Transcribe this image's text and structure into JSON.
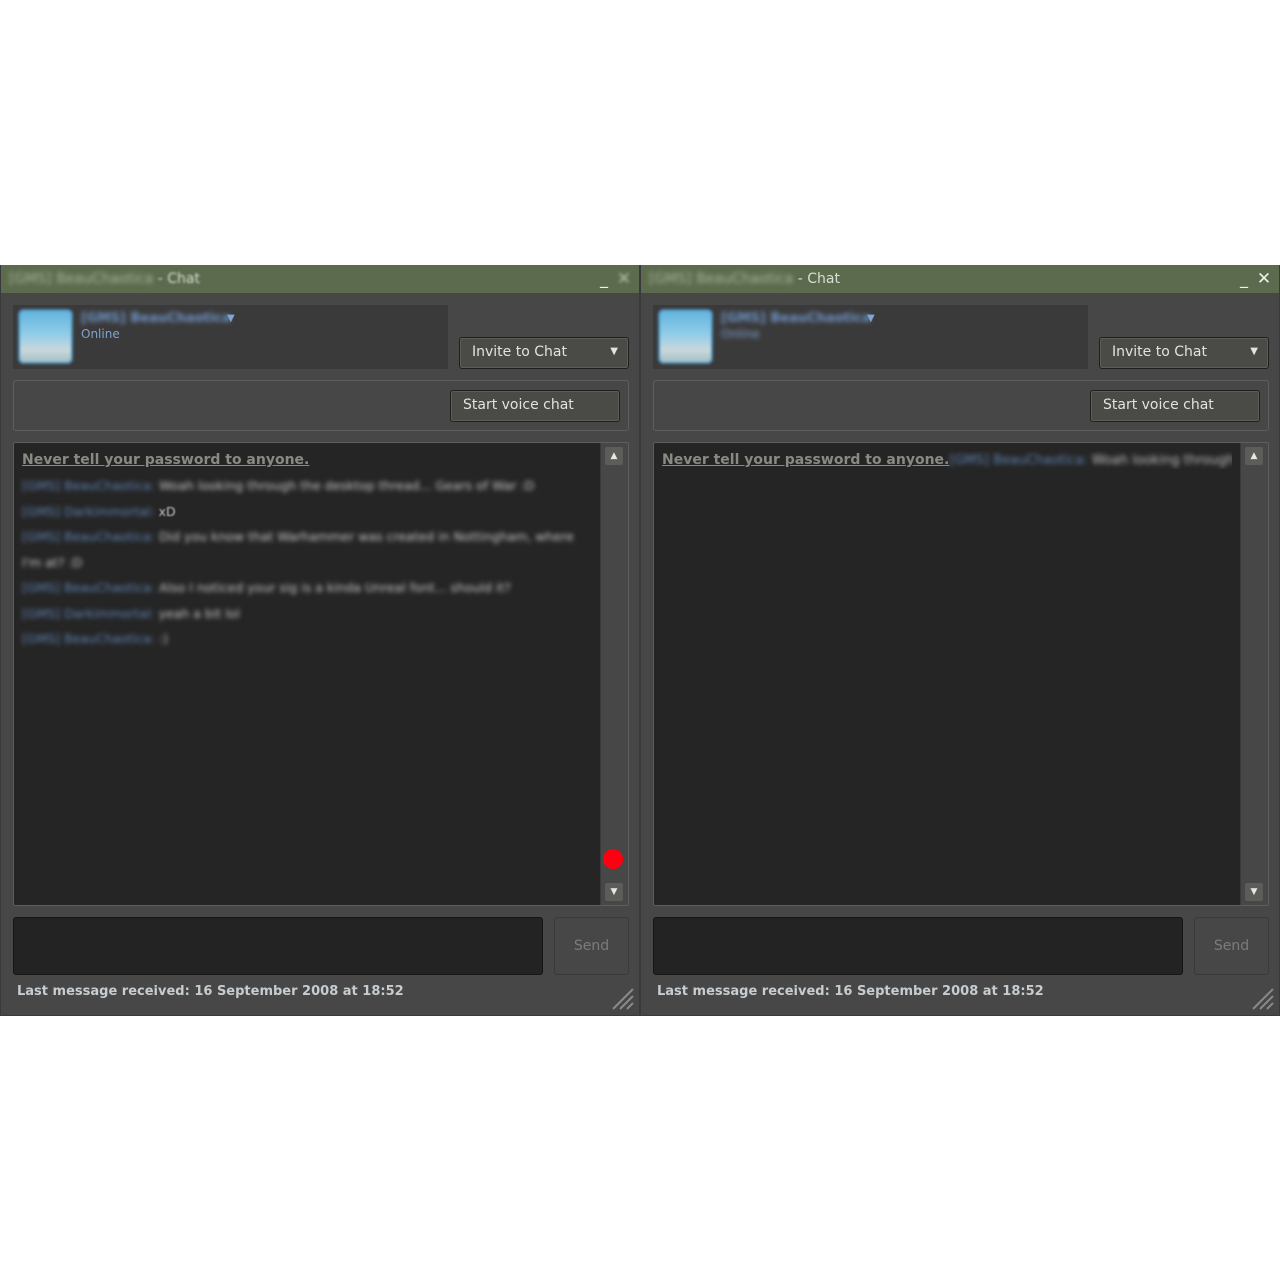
{
  "windows": [
    {
      "id": "left",
      "title_name": "[GMS] BeauChaotica",
      "title_suffix": " - Chat",
      "minimize_glyph": "_",
      "close_glyph": "✕",
      "profile": {
        "name": "[GMS] BeauChaotica",
        "status": "Online",
        "caret": "▼"
      },
      "invite_label": "Invite to Chat",
      "invite_caret": "▼",
      "voice_label": "Start voice chat",
      "warning": "Never tell your password to anyone.",
      "messages": [
        {
          "who": "[GMS] BeauChaotica:",
          "text": "Woah looking through the desktop thread... Gears of War :D"
        },
        {
          "who": "[GMS] Darkimmortal:",
          "text": "xD",
          "clear": true
        },
        {
          "who": "[GMS] BeauChaotica:",
          "text": "Did you know that Warhammer was created in Nottingham, where"
        },
        {
          "who": "",
          "text": "I'm at? :D"
        },
        {
          "who": "[GMS] BeauChaotica:",
          "text": "Also I noticed your sig is a kinda Unreal font... should it?"
        },
        {
          "who": "[GMS] Darkimmortal:",
          "text": "yeah a bit lol"
        },
        {
          "who": "[GMS] BeauChaotica:",
          "text": ":)"
        }
      ],
      "scroll_up": "▲",
      "scroll_down": "▼",
      "input_value": "",
      "send_label": "Send",
      "status": "Last message received: 16 September 2008 at 18:52",
      "show_click_marker": true
    },
    {
      "id": "right",
      "title_name": "[GMS] BeauChaotica",
      "title_suffix": " - Chat",
      "minimize_glyph": "_",
      "close_glyph": "✕",
      "profile": {
        "name": "[GMS] BeauChaotica",
        "status": "Online",
        "caret": "▼"
      },
      "invite_label": "Invite to Chat",
      "invite_caret": "▼",
      "voice_label": "Start voice chat",
      "warning": "Never tell your password to anyone.",
      "inline_message": {
        "who": "[GMS] BeauChaotica:",
        "text": "Woah looking through the"
      },
      "scroll_up": "▲",
      "scroll_down": "▼",
      "input_value": "",
      "send_label": "Send",
      "status": "Last message received: 16 September 2008 at 18:52",
      "show_click_marker": false
    }
  ],
  "colors": {
    "titlebar": "#5c6b4d",
    "window_bg": "#474747",
    "chat_bg": "#252525",
    "username": "#5f85b4",
    "click_marker": "#ff0010"
  }
}
